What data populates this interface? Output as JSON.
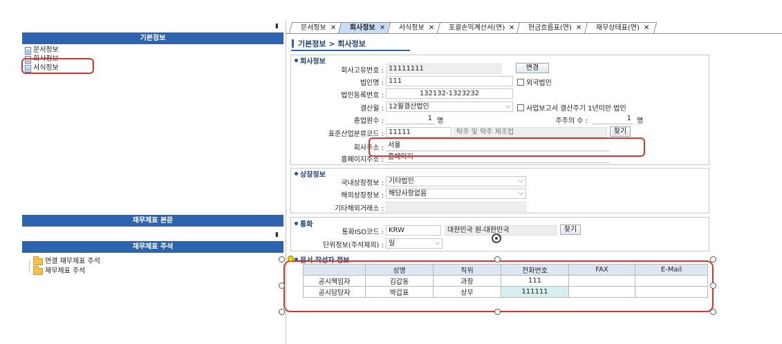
{
  "left_panel": {
    "pin_icon": "pin-icon",
    "basic_info_header": "기본정보",
    "basic_items": [
      "문서정보",
      "회사정보",
      "서식정보"
    ],
    "fin_body_header": "재무제표 본문",
    "fin_notes_header": "재무제표 주석",
    "notes_items": [
      "연결 재무제표 주석",
      "재무제표 주석"
    ]
  },
  "tabs": [
    {
      "label": "문서정보",
      "active": false
    },
    {
      "label": "회사정보",
      "active": true
    },
    {
      "label": "서식정보",
      "active": false
    },
    {
      "label": "포괄손익계산서(연)",
      "active": false
    },
    {
      "label": "현금흐름표(연)",
      "active": false
    },
    {
      "label": "재무상태표(연)",
      "active": false
    }
  ],
  "tab_close": "✕",
  "breadcrumb": "기본정보 > 회사정보",
  "company": {
    "title": "회사정보",
    "uid_label": "회사고유번호 :",
    "uid_value": "11111111",
    "change_button": "변경",
    "name_label": "법인명 :",
    "name_value": "111",
    "foreign_label": "외국법인",
    "reg_label": "법인등록번호 :",
    "reg_value": "132132-1323232",
    "fiscal_label": "결산월 :",
    "fiscal_value": "12월결산법인",
    "short_fiscal_label": "사업보고서 결산주기 1년미만 법인",
    "employees_label": "종업원수 :",
    "employees_value": "1",
    "employees_unit": "명",
    "shareholders_label": "주주의 수 :",
    "shareholders_value": "1",
    "shareholders_unit": "명",
    "industry_label": "표준산업분류코드 :",
    "industry_code": "11111",
    "industry_name": "탁주 및 약주 제조업",
    "find_button": "찾기",
    "address_label": "회사주소 :",
    "address_value": "서울",
    "homepage_label": "홈페이지주소 :",
    "homepage_value": "홈페이지"
  },
  "listing": {
    "title": "상장정보",
    "domestic_label": "국내상장정보 :",
    "domestic_value": "기타법인",
    "overseas_label": "해외상장정보 :",
    "overseas_value": "해당사항없음",
    "other_label": "기타해외거래소 :",
    "other_value": ""
  },
  "currency": {
    "title": "통화",
    "iso_label": "통화ISO코드 :",
    "iso_value": "KRW",
    "iso_name": "대한민국 원-대한민국",
    "find_button": "찾기",
    "unit_label": "단위정보(주석제외) :",
    "unit_value": "일"
  },
  "authors": {
    "title": "문서 작성자 정보",
    "columns": [
      "",
      "성명",
      "직위",
      "전화번호",
      "FAX",
      "E-Mail"
    ],
    "rows": [
      [
        "공시책임자",
        "김갑동",
        "과장",
        "111",
        "",
        ""
      ],
      [
        "공시담당자",
        "박갑표",
        "상무",
        "111111",
        "",
        ""
      ]
    ]
  },
  "colors": {
    "header_blue": "#2e63b0",
    "active_tab": "#c9dcf5",
    "annotation_red": "#d9342b"
  }
}
